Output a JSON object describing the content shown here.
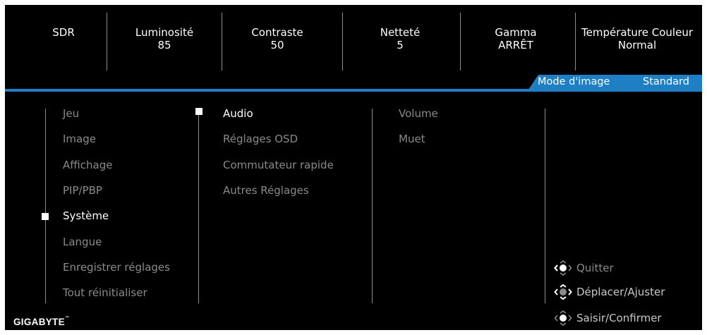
{
  "header": {
    "items": [
      {
        "label": "SDR",
        "value": ""
      },
      {
        "label": "Luminosité",
        "value": "85"
      },
      {
        "label": "Contraste",
        "value": "50"
      },
      {
        "label": "Netteté",
        "value": "5"
      },
      {
        "label": "Gamma",
        "value": "ARRÊT"
      },
      {
        "label": "Température Couleur",
        "value": "Normal"
      }
    ]
  },
  "picture_mode": {
    "label": "Mode d'image",
    "value": "Standard"
  },
  "main_menu": {
    "items": [
      "Jeu",
      "Image",
      "Affichage",
      "PIP/PBP",
      "Système",
      "Langue",
      "Enregistrer réglages",
      "Tout réinitialiser"
    ],
    "selected": "Système"
  },
  "sub_menu": {
    "items": [
      "Audio",
      "Réglages OSD",
      "Commutateur rapide",
      "Autres Réglages"
    ],
    "selected": "Audio"
  },
  "sub_sub_menu": {
    "items": [
      "Volume",
      "Muet"
    ]
  },
  "hints": [
    {
      "icon": "joystick-left-icon",
      "label": "Quitter"
    },
    {
      "icon": "joystick-move-icon",
      "label": "Déplacer/Ajuster"
    },
    {
      "icon": "joystick-press-icon",
      "label": "Saisir/Confirmer"
    }
  ],
  "brand": {
    "logo_text": "GIGABYTE",
    "trademark": "™"
  },
  "colors": {
    "accent": "#1e7fc4",
    "background": "#000000",
    "inactive_text": "#8a8a8a",
    "active_text": "#ffffff"
  }
}
